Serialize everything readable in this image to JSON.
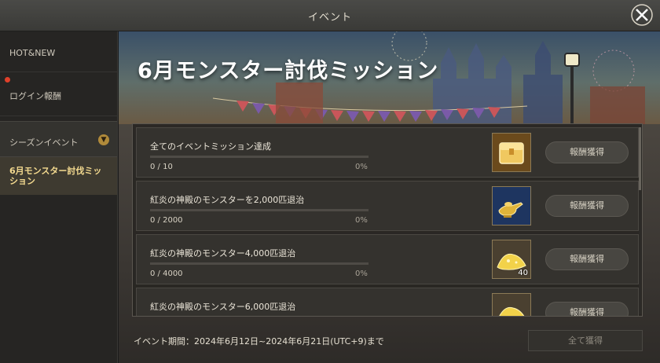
{
  "header": {
    "title": "イベント"
  },
  "sidebar": {
    "items": [
      {
        "label": "HOT&NEW"
      },
      {
        "label": "ログイン報酬"
      },
      {
        "label": "シーズンイベント"
      },
      {
        "label": "6月モンスター討伐ミッション"
      }
    ]
  },
  "banner": {
    "title": "6月モンスター討伐ミッション"
  },
  "missions": [
    {
      "name": "全てのイベントミッション達成",
      "progress": "0 / 10",
      "percent": "0%",
      "fraction": 0,
      "icon": "treasure-chest-icon",
      "count": "",
      "button": "報酬獲得"
    },
    {
      "name": "紅炎の神殿のモンスターを2,000匹退治",
      "progress": "0 / 2000",
      "percent": "0%",
      "fraction": 0,
      "icon": "magic-lamp-icon",
      "count": "",
      "button": "報酬獲得"
    },
    {
      "name": "紅炎の神殿のモンスター4,000匹退治",
      "progress": "0 / 4000",
      "percent": "0%",
      "fraction": 0,
      "icon": "gold-powder-icon",
      "count": "40",
      "button": "報酬獲得"
    },
    {
      "name": "紅炎の神殿のモンスター6,000匹退治",
      "progress": "",
      "percent": "",
      "fraction": 0,
      "icon": "gold-powder-icon",
      "count": "",
      "button": "報酬獲得"
    }
  ],
  "footer": {
    "period": "イベント期間：2024年6月12日~2024年6月21日(UTC+9)まで",
    "claim_all": "全て獲得"
  },
  "colors": {
    "accent": "#f3d98f",
    "notification": "#e0402a"
  }
}
